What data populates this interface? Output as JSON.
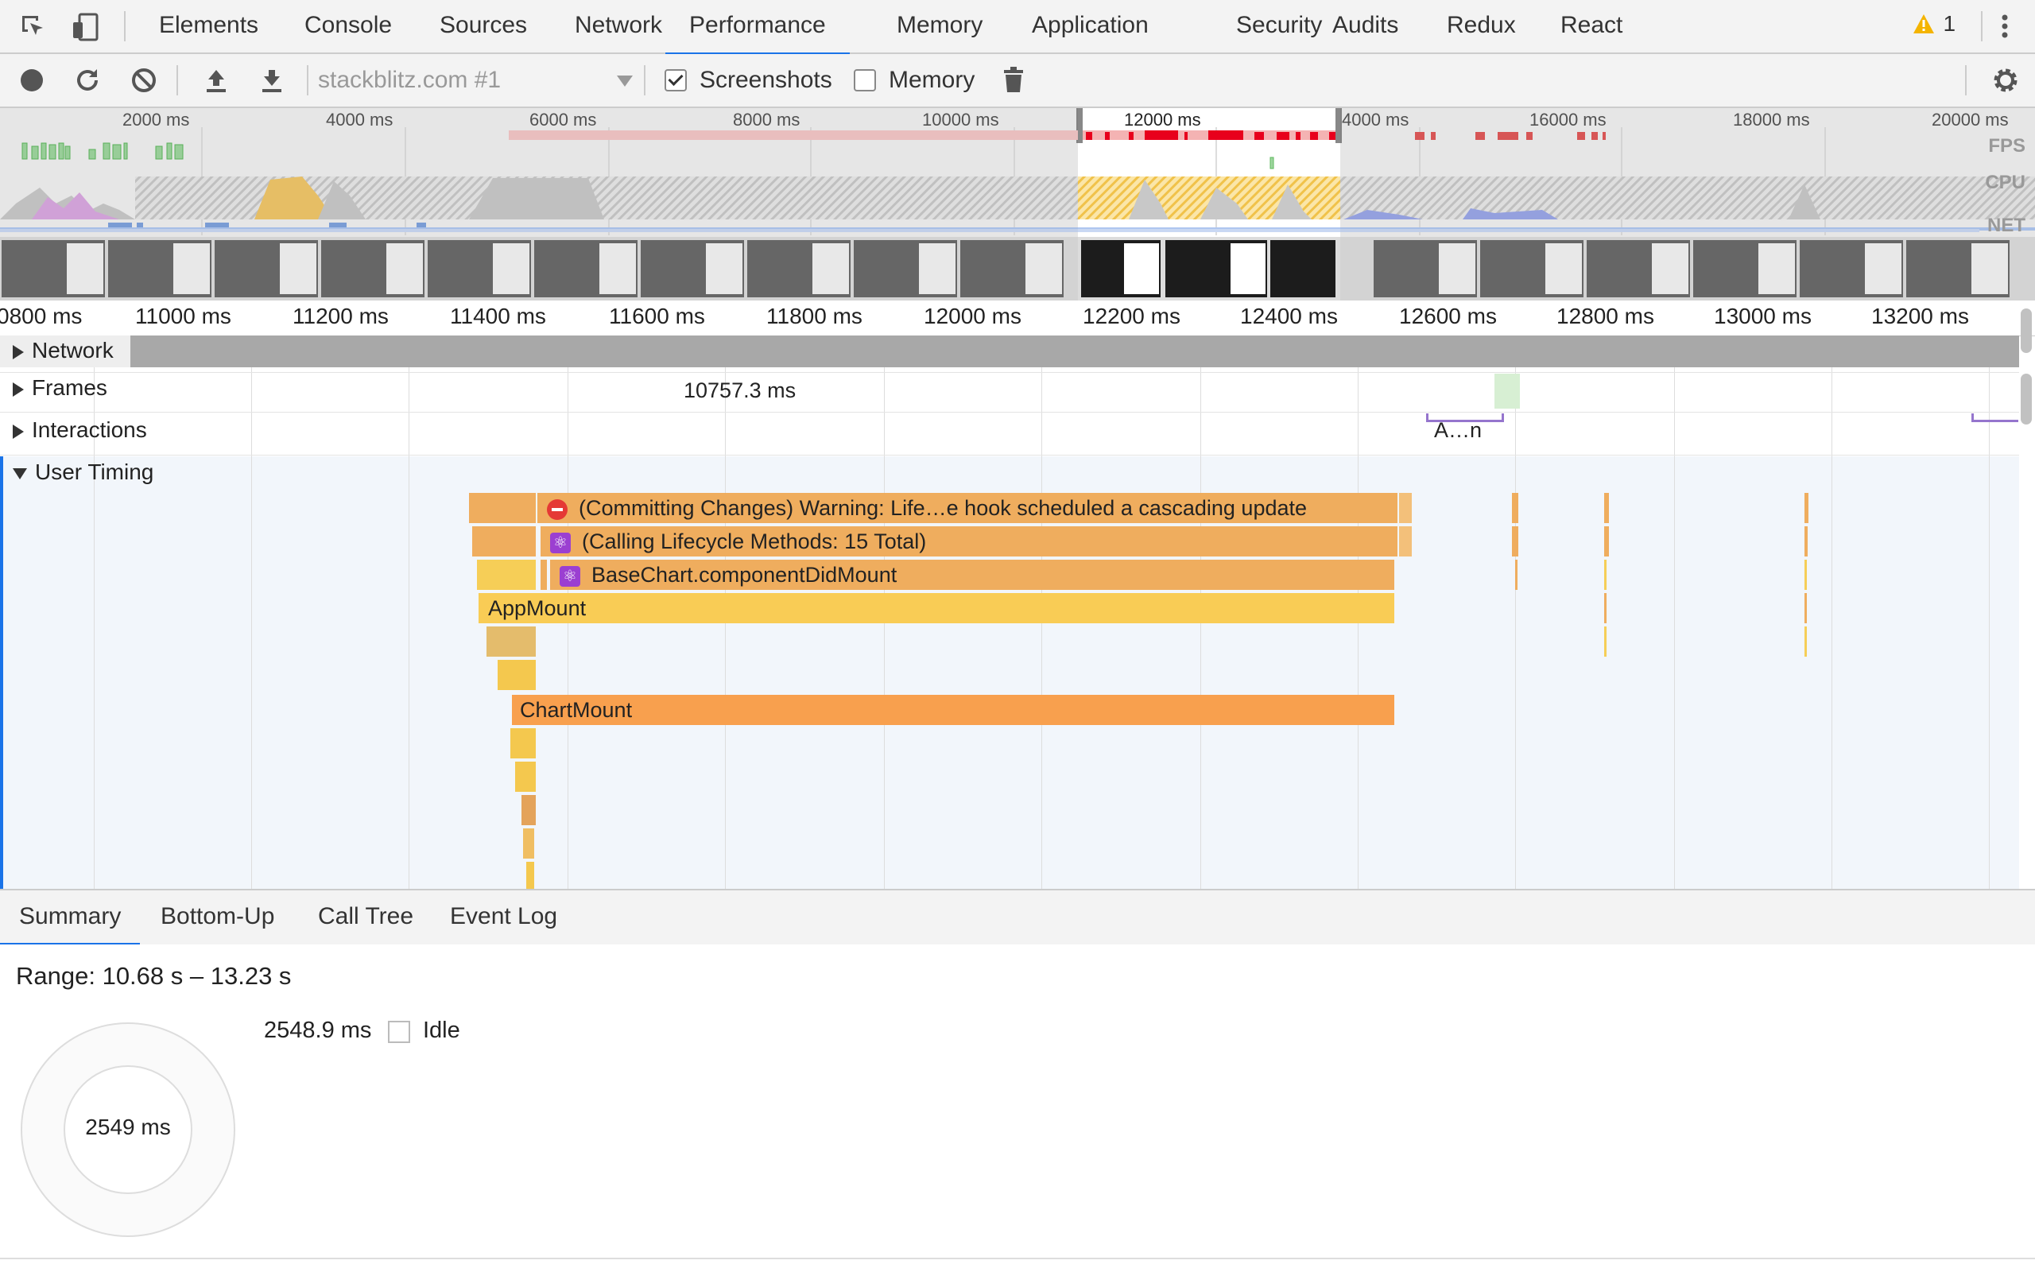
{
  "devtools": {
    "tabs": [
      {
        "label": "Elements"
      },
      {
        "label": "Console"
      },
      {
        "label": "Sources"
      },
      {
        "label": "Network"
      },
      {
        "label": "Performance",
        "active": true
      },
      {
        "label": "Memory"
      },
      {
        "label": "Application"
      },
      {
        "label": "Security"
      },
      {
        "label": "Audits"
      },
      {
        "label": "Redux"
      },
      {
        "label": "React"
      }
    ],
    "warning_count": "1"
  },
  "toolbar": {
    "target_select": "stackblitz.com #1",
    "screenshots_label": "Screenshots",
    "screenshots_checked": true,
    "memory_label": "Memory",
    "memory_checked": false
  },
  "overview": {
    "time_labels": [
      "2000 ms",
      "4000 ms",
      "6000 ms",
      "8000 ms",
      "10000 ms",
      "12000 ms",
      "4000 ms",
      "16000 ms",
      "18000 ms",
      "20000 ms"
    ],
    "track_labels": {
      "fps": "FPS",
      "cpu": "CPU",
      "net": "NET"
    }
  },
  "ruler": {
    "labels": [
      "0800 ms",
      "11000 ms",
      "11200 ms",
      "11400 ms",
      "11600 ms",
      "11800 ms",
      "12000 ms",
      "12200 ms",
      "12400 ms",
      "12600 ms",
      "12800 ms",
      "13000 ms",
      "13200 ms"
    ]
  },
  "tracks": {
    "network": "Network",
    "frames": "Frames",
    "frames_value": "10757.3 ms",
    "interactions": "Interactions",
    "interaction_label": "A…n",
    "user_timing": "User Timing"
  },
  "user_timing_bars": [
    {
      "label": "(Committing Changes) Warning: Life…e hook scheduled a cascading update"
    },
    {
      "label": "(Calling Lifecycle Methods: 15 Total)"
    },
    {
      "label": "BaseChart.componentDidMount"
    },
    {
      "label": "AppMount"
    },
    {
      "label": "ChartMount"
    }
  ],
  "bottom_tabs": [
    {
      "label": "Summary",
      "active": true
    },
    {
      "label": "Bottom-Up"
    },
    {
      "label": "Call Tree"
    },
    {
      "label": "Event Log"
    }
  ],
  "summary": {
    "range": "Range: 10.68 s – 13.23 s",
    "total": "2549 ms",
    "legend": [
      {
        "value": "2548.9 ms",
        "label": "Idle",
        "color": "#ffffff"
      }
    ]
  },
  "colors": {
    "accent": "#1a73e8",
    "flame_orange": "#efb05c",
    "flame_yellow": "#f9cd55",
    "flame_dark_orange": "#f8a04e",
    "react_badge": "#9b3fd1",
    "warning": "#e53935"
  }
}
